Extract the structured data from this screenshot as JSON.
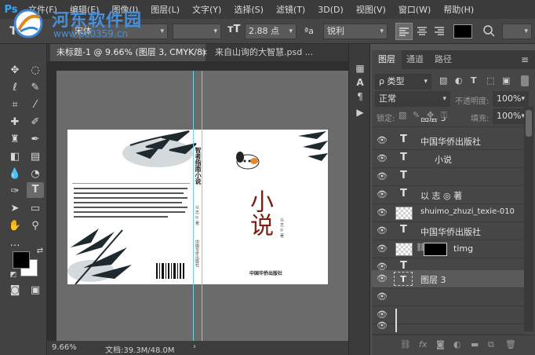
{
  "app": {
    "logo": "Ps"
  },
  "watermark": {
    "title": "河东软件园",
    "url": "www.pc0359.cn"
  },
  "menu": [
    "文件(F)",
    "编辑(E)",
    "图像(I)",
    "图层(L)",
    "文字(Y)",
    "选择(S)",
    "滤镜(T)",
    "3D(D)",
    "视图(V)",
    "窗口(W)",
    "帮助(H)"
  ],
  "options": {
    "font_family": "宋体",
    "font_size": "2.88 点",
    "aa_label": "ªa",
    "antialias": "锐利",
    "text_color": "#000000"
  },
  "tabs": [
    {
      "label": "未标题-1 @ 9.66% (图层 3, CMYK/8) *",
      "close": "×"
    },
    {
      "label": "来自山询的大智慧.psd ..."
    }
  ],
  "status": {
    "zoom": "9.66%",
    "doc": "文档:39.3M/48.0M"
  },
  "panel": {
    "tabs": [
      "图层",
      "通道",
      "路径"
    ],
    "filter_label": "ρ 类型",
    "blend_mode": "正常",
    "opacity_label": "不透明度:",
    "opacity_value": "100%",
    "lock_label": "锁定:",
    "fill_label": "填充:",
    "fill_value": "100%"
  },
  "layers": [
    {
      "type": "text",
      "name": "图层 3"
    },
    {
      "type": "text",
      "name": "中国华侨出版社"
    },
    {
      "type": "text",
      "name": "小说"
    },
    {
      "type": "text",
      "name": ""
    },
    {
      "type": "text",
      "name": "以 志 ◎ 著"
    },
    {
      "type": "image",
      "name": "shuimo_zhuzi_texie-010"
    },
    {
      "type": "text",
      "name": "中国华侨出版社"
    },
    {
      "type": "masked",
      "name": "timg"
    },
    {
      "type": "text",
      "name": ""
    },
    {
      "type": "text",
      "name": "图层 3"
    },
    {
      "type": "empty",
      "name": ""
    },
    {
      "type": "empty",
      "name": ""
    },
    {
      "type": "empty",
      "name": ""
    }
  ],
  "book": {
    "spine_title": "智者指南小说",
    "spine_author": "以 志 ◎ 著",
    "spine_publisher": "中国华侨出版社",
    "front_title": "小说",
    "front_author": "以 志 ◎ 著",
    "front_publisher": "中国华侨出版社"
  },
  "colors": {
    "accent": "#31a8ff",
    "guide": "#6fd3e6",
    "title_red": "#7a1f14"
  }
}
